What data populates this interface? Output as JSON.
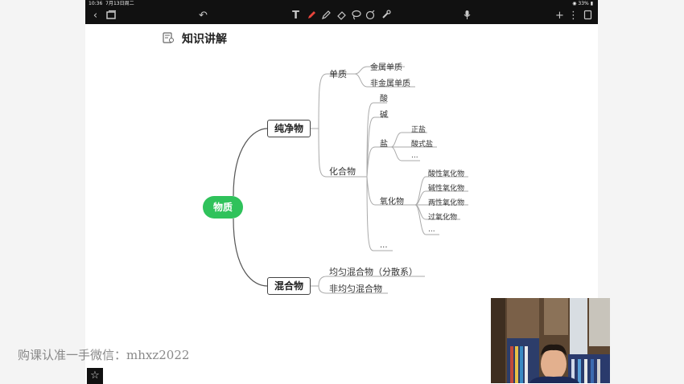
{
  "status": {
    "time": "10:36",
    "date": "7月13日周二",
    "battery": "33%"
  },
  "toolbar": {
    "back_icon": "chevron-left-icon",
    "pages_icon": "pages-icon",
    "undo_icon": "undo-icon",
    "text_icon": "text-tool-icon",
    "pen_icon": "pen-icon",
    "highlighter_icon": "highlighter-icon",
    "eraser_icon": "eraser-icon",
    "lasso_icon": "lasso-icon",
    "shape_icon": "shape-icon",
    "laser_icon": "laser-pointer-icon",
    "mic_icon": "microphone-icon",
    "add_icon": "plus-icon",
    "more_icon": "more-icon",
    "window_icon": "window-icon",
    "accent_color": "#e8453c"
  },
  "page": {
    "title": "知识讲解"
  },
  "mindmap": {
    "root": "物质",
    "pure": "纯净物",
    "mixture": "混合物",
    "element": "单质",
    "element_children": [
      "金属单质",
      "非金属单质"
    ],
    "compound": "化合物",
    "acid": "酸",
    "base": "碱",
    "salt": "盐",
    "salt_children": [
      "正盐",
      "酸式盐",
      "..."
    ],
    "oxide": "氧化物",
    "oxide_children": [
      "酸性氧化物",
      "碱性氧化物",
      "两性氧化物",
      "过氧化物",
      "..."
    ],
    "compound_more": "...",
    "mixture_children": [
      "均匀混合物（分散系）",
      "非均匀混合物"
    ],
    "root_color": "#2fc25b"
  },
  "watermark": "购课认准一手微信：mhxz2022",
  "star_icon": "star-icon"
}
